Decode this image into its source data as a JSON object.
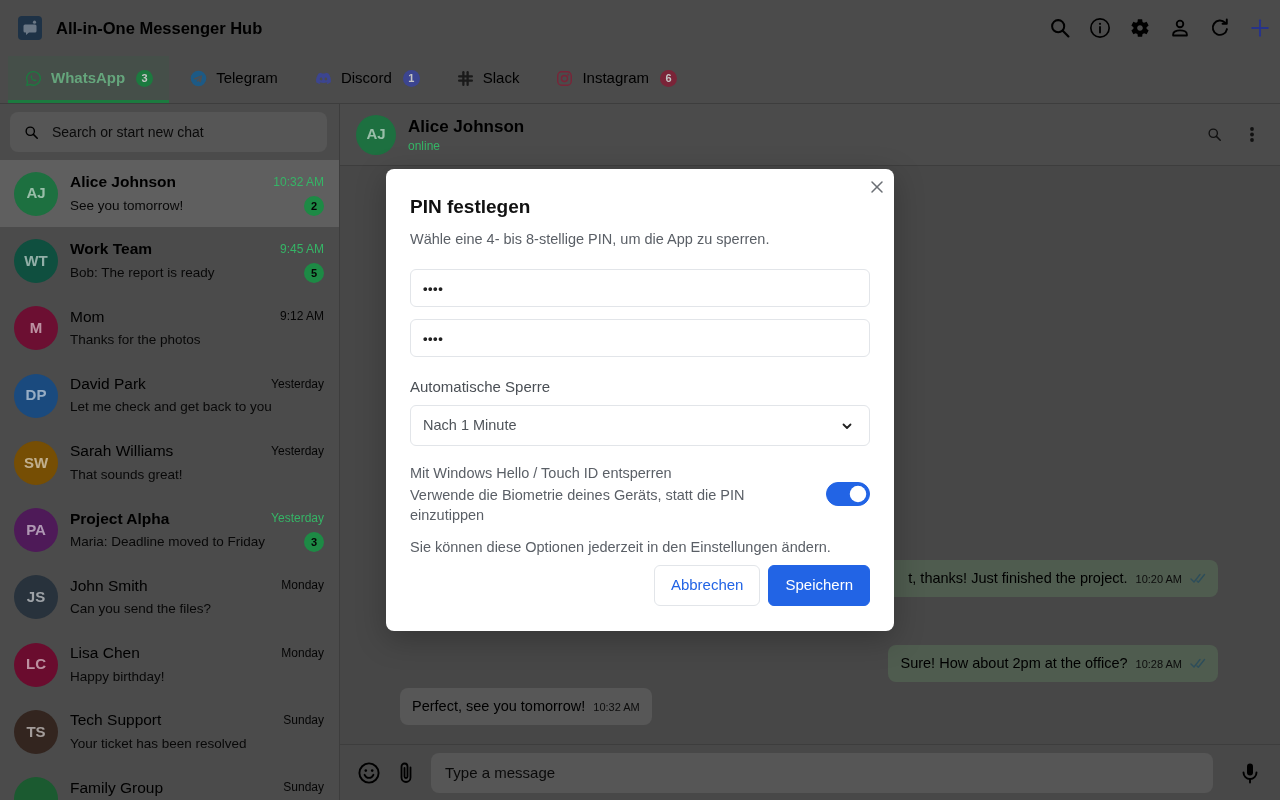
{
  "app": {
    "title": "All-in-One Messenger Hub"
  },
  "tabs": [
    {
      "label": "WhatsApp",
      "badge": "3",
      "color": "#1c7a3f",
      "selected": true
    },
    {
      "label": "Telegram",
      "color": "#1d5a85",
      "selected": false
    },
    {
      "label": "Discord",
      "badge": "1",
      "color": "#3c4590",
      "selected": false
    },
    {
      "label": "Slack",
      "color": "#1a1a1a",
      "selected": false
    },
    {
      "label": "Instagram",
      "badge": "6",
      "color": "#7a2438",
      "selected": false
    }
  ],
  "sidebar": {
    "search": {
      "placeholder": "Search or start new chat"
    },
    "chats": [
      {
        "initials": "AJ",
        "name": "Alice Johnson",
        "time": "10:32 AM",
        "preview": "See you tomorrow!",
        "unread": "2",
        "color": "#1d7040",
        "selected": true
      },
      {
        "initials": "WT",
        "name": "Work Team",
        "time": "9:45 AM",
        "preview": "Bob: The report is ready",
        "unread": "5",
        "color": "#0f4f3f",
        "selected": false
      },
      {
        "initials": "M",
        "name": "Mom",
        "time": "9:12 AM",
        "preview": "Thanks for the photos",
        "color": "#6c0f32",
        "selected": false
      },
      {
        "initials": "DP",
        "name": "David Park",
        "time": "Yesterday",
        "preview": "Let me check and get back to you",
        "color": "#1a4a7e",
        "selected": false
      },
      {
        "initials": "SW",
        "name": "Sarah Williams",
        "time": "Yesterday",
        "preview": "That sounds great!",
        "color": "#764e04",
        "selected": false
      },
      {
        "initials": "PA",
        "name": "Project Alpha",
        "time": "Yesterday",
        "preview": "Maria: Deadline moved to Friday",
        "unread": "3",
        "color": "#4e1a58",
        "selected": false
      },
      {
        "initials": "JS",
        "name": "John Smith",
        "time": "Monday",
        "preview": "Can you send the files?",
        "color": "#28323c",
        "selected": false
      },
      {
        "initials": "LC",
        "name": "Lisa Chen",
        "time": "Monday",
        "preview": "Happy birthday!",
        "color": "#6a0c2e",
        "selected": false
      },
      {
        "initials": "TS",
        "name": "Tech Support",
        "time": "Sunday",
        "preview": "Your ticket has been resolved",
        "color": "#33251f",
        "selected": false
      },
      {
        "name": "Family Group",
        "time": "Sunday",
        "color": "#1b5a30",
        "selected": false
      }
    ]
  },
  "chat": {
    "header": {
      "initials": "AJ",
      "name": "Alice Johnson",
      "status": "online"
    },
    "messages": [
      {
        "kind": "outgoing",
        "text": "t, thanks! Just finished the project.",
        "time": "10:20 AM"
      },
      {
        "kind": "outgoing",
        "text": "Sure! How about 2pm at the office?",
        "time": "10:28 AM"
      },
      {
        "kind": "incoming",
        "text": "Perfect, see you tomorrow!",
        "time": "10:32 AM"
      }
    ],
    "composer": {
      "placeholder": "Type a message"
    }
  },
  "dialog": {
    "title": "PIN festlegen",
    "description": "Wähle eine 4- bis 8-stellige PIN, um die App zu sperren.",
    "pin_fields": [
      {
        "value": "••••"
      },
      {
        "value": "••••"
      }
    ],
    "auto_lock": {
      "label": "Automatische Sperre",
      "value": "Nach 1 Minute"
    },
    "biometric": {
      "title": "Mit Windows Hello / Touch ID entsperren",
      "description": "Verwende die Biometrie deines Geräts, statt die PIN einzutippen",
      "on": true
    },
    "note": "Sie können diese Optionen jederzeit in den Einstellungen ändern.",
    "buttons": [
      {
        "label": "Abbrechen",
        "kind": "secondary"
      },
      {
        "label": "Speichern",
        "kind": "primary"
      }
    ]
  }
}
